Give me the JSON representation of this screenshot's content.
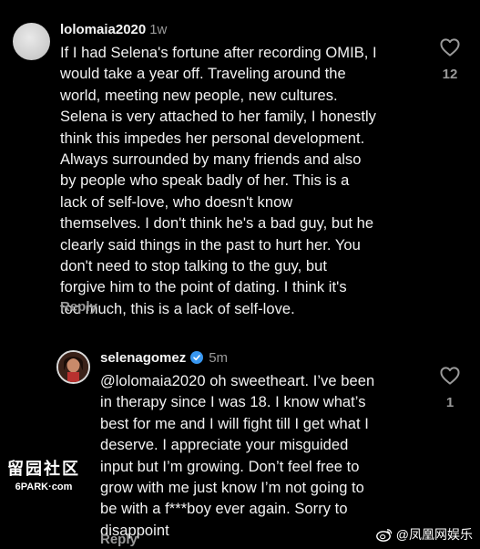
{
  "comment_1": {
    "username": "lolomaia2020",
    "time": "1w",
    "text_lines": [
      "If I had Selena's fortune after recording OMIB, I",
      "would take a year off. Traveling around the",
      "world, meeting new people, new cultures.",
      "Selena is very attached to her family, I honestly",
      "think this impedes her personal development.",
      "Always surrounded by many friends and also",
      "by people who speak badly of her. This is a",
      "lack of self-love, who doesn't know",
      "themselves. I don't think he's a bad guy, but he",
      "clearly said things in the past to hurt her. You",
      "don't need to stop talking to the guy, but",
      "forgive him to the point of dating. I think it's",
      "too much, this is a lack of self-love."
    ],
    "reply_label": "Reply",
    "like_count": "12"
  },
  "comment_2": {
    "username": "selenagomez",
    "time": "5m",
    "text_lines": [
      "@lolomaia2020 oh sweetheart. I’ve been",
      "in therapy since I was 18. I know what’s",
      "best for me and I will fight till I get what I",
      "deserve. I appreciate your misguided",
      "input but I’m growing. Don’t feel free to",
      "grow with me just know I’m not going to",
      "be with a f***boy ever again. Sorry to",
      "disappoint"
    ],
    "reply_label": "Reply",
    "like_count": "1"
  },
  "watermarks": {
    "left_chars": "留园社区",
    "left_site": "6PARK·com",
    "right_text": "@凤凰网娱乐"
  },
  "colors": {
    "background": "#000000",
    "text": "#f2f2f2",
    "muted": "#9a9a9a",
    "verified": "#3897f0"
  },
  "icons": {
    "like": "heart-outline-icon",
    "verified": "verified-badge-icon",
    "weibo": "weibo-logo-icon"
  }
}
